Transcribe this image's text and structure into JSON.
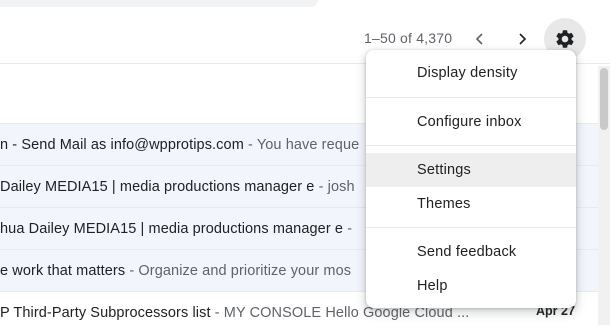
{
  "toolbar": {
    "pagination": "1–50 of 4,370",
    "prev_icon": "chevron-left-icon",
    "next_icon": "chevron-right-icon",
    "settings_icon": "gear-icon"
  },
  "colors": {
    "read_row_bg": "#f2f6fc",
    "unread_row_bg": "#ffffff",
    "menu_hover_bg": "#eeeeee",
    "gear_button_bg": "#e8e8e8"
  },
  "emails": [
    {
      "subject": "n - Send Mail as info@wpprotips.com",
      "snippet": " - You have reque",
      "date": "",
      "read": true
    },
    {
      "subject": "Dailey MEDIA15 | media productions manager e",
      "snippet": " - josh",
      "date": "",
      "read": true
    },
    {
      "subject": "hua Dailey MEDIA15 | media productions manager e",
      "snippet": " - ",
      "date": "",
      "read": true
    },
    {
      "subject": "e work that matters",
      "snippet": " - Organize and prioritize your mos",
      "date": "",
      "read": true
    },
    {
      "subject": "P Third-Party Subprocessors list",
      "snippet": " - MY CONSOLE Hello Google Cloud ...",
      "date": "Apr 27",
      "read": false
    }
  ],
  "settings_menu": {
    "items": [
      {
        "label": "Display density"
      },
      {
        "label": "Configure inbox"
      },
      {
        "label": "Settings"
      },
      {
        "label": "Themes"
      },
      {
        "label": "Send feedback"
      },
      {
        "label": "Help"
      }
    ],
    "highlighted": "Settings"
  }
}
